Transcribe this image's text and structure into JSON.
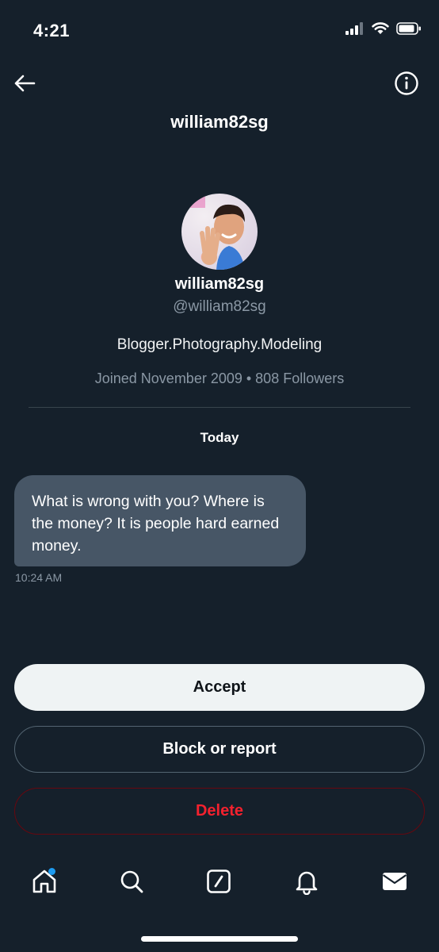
{
  "status_bar": {
    "time": "4:21",
    "icons": [
      "signal-icon",
      "wifi-icon",
      "battery-icon"
    ]
  },
  "header": {
    "title": "william82sg",
    "back_icon": "back-arrow-icon",
    "info_icon": "info-icon"
  },
  "profile": {
    "name": "william82sg",
    "handle": "@william82sg",
    "bio": "Blogger.Photography.Modeling",
    "meta": "Joined November 2009 • 808 Followers"
  },
  "conversation": {
    "date_label": "Today",
    "messages": [
      {
        "text": "What is wrong with you? Where is the money? It is people hard earned money.",
        "time": "10:24 AM"
      }
    ]
  },
  "actions": {
    "accept_label": "Accept",
    "block_label": "Block or report",
    "delete_label": "Delete"
  },
  "nav": {
    "items": [
      "home-icon",
      "search-icon",
      "compose-icon",
      "notifications-icon",
      "messages-icon"
    ],
    "unread_dot_color": "#1d9bf0"
  },
  "colors": {
    "background": "#15202b",
    "bubble": "#475666",
    "delete": "#f4212e",
    "accent": "#1d9bf0"
  }
}
